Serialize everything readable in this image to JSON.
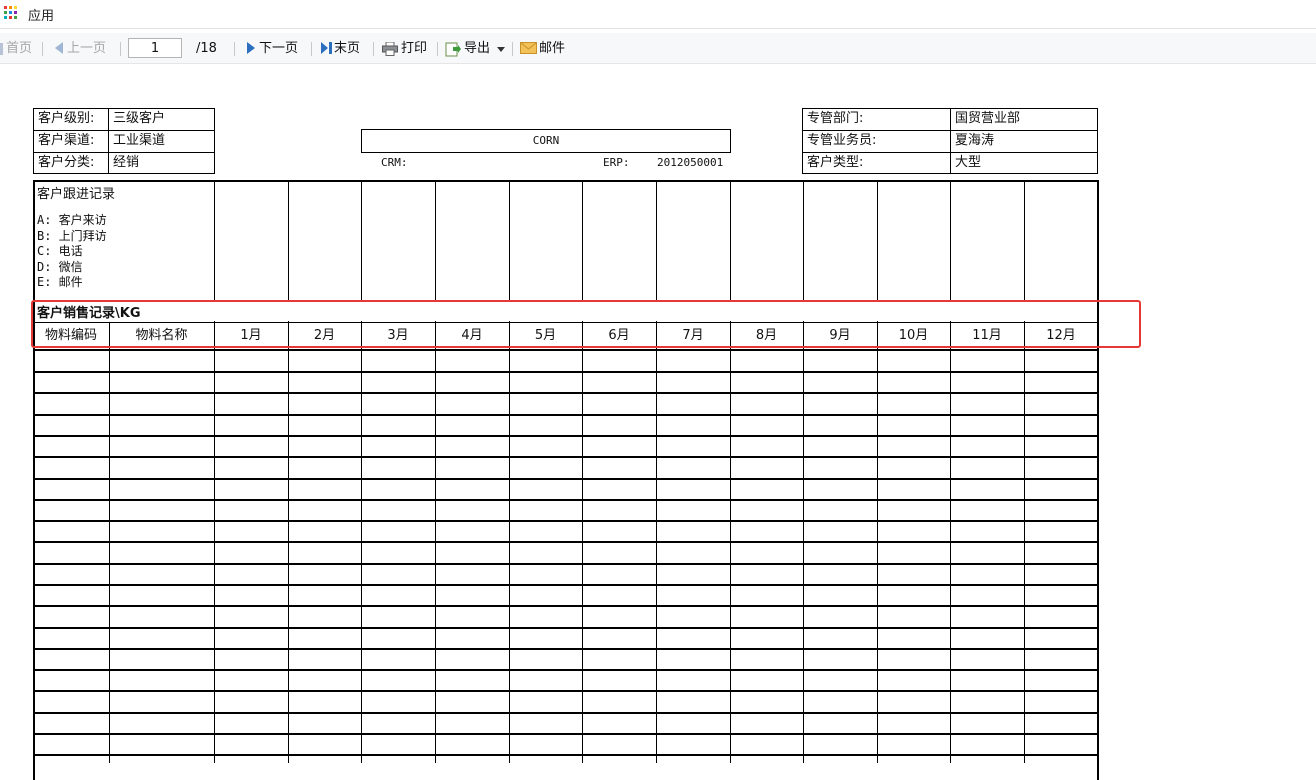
{
  "app": {
    "title": "应用"
  },
  "toolbar": {
    "first": "首页",
    "prev": "上一页",
    "page_value": "1",
    "page_total": "/18",
    "next": "下一页",
    "last": "末页",
    "print": "打印",
    "export": "导出",
    "mail": "邮件"
  },
  "header_left": [
    {
      "label": "客户级别:",
      "value": "三级客户"
    },
    {
      "label": "客户渠道:",
      "value": "工业渠道"
    },
    {
      "label": "客户分类:",
      "value": "经销"
    }
  ],
  "header_center": {
    "product": "CORN",
    "crm_label": "CRM:",
    "crm_value": "",
    "erp_label": "ERP:",
    "erp_value": "2012050001"
  },
  "header_right": [
    {
      "label": "专管部门:",
      "value": "国贸营业部"
    },
    {
      "label": "专管业务员:",
      "value": "夏海涛"
    },
    {
      "label": "客户类型:",
      "value": "大型"
    }
  ],
  "followup": {
    "title": "客户跟进记录",
    "items": [
      "A: 客户来访",
      "B: 上门拜访",
      "C: 电话",
      "D: 微信",
      "E: 邮件"
    ]
  },
  "sales": {
    "title": "客户销售记录\\KG",
    "columns": [
      "物料编码",
      "物料名称",
      "1月",
      "2月",
      "3月",
      "4月",
      "5月",
      "6月",
      "7月",
      "8月",
      "9月",
      "10月",
      "11月",
      "12月"
    ]
  },
  "colors": {
    "highlight": "#e53935",
    "grid": "#000000"
  }
}
